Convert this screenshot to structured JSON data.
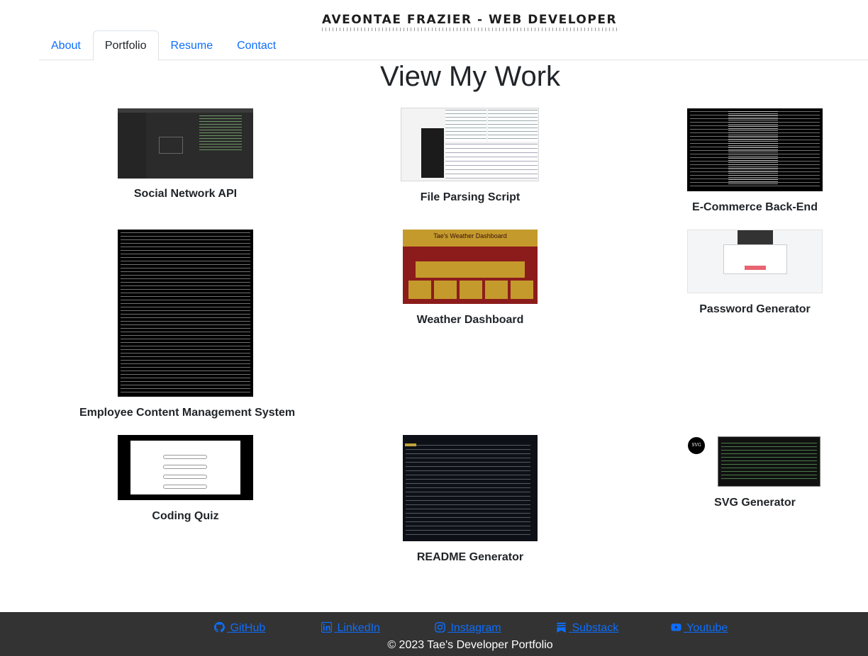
{
  "header": {
    "title": "AVEONTAE FRAZIER - WEB DEVELOPER"
  },
  "nav": {
    "tabs": [
      {
        "label": "About",
        "active": false
      },
      {
        "label": "Portfolio",
        "active": true
      },
      {
        "label": "Resume",
        "active": false
      },
      {
        "label": "Contact",
        "active": false
      }
    ]
  },
  "main": {
    "heading": "View My Work",
    "projects": [
      {
        "title": "Social Network API"
      },
      {
        "title": "File Parsing Script"
      },
      {
        "title": "E-Commerce Back-End"
      },
      {
        "title": "Employee Content Management System"
      },
      {
        "title": "Weather Dashboard",
        "thumb_text": "Tae's Weather Dashboard"
      },
      {
        "title": "Password Generator"
      },
      {
        "title": "Coding Quiz"
      },
      {
        "title": "README Generator"
      },
      {
        "title": "SVG Generator",
        "thumb_text": "SVG"
      }
    ]
  },
  "footer": {
    "links": [
      {
        "label": " GitHub",
        "icon": "github-icon"
      },
      {
        "label": " LinkedIn",
        "icon": "linkedin-icon"
      },
      {
        "label": " Instagram",
        "icon": "instagram-icon"
      },
      {
        "label": " Substack",
        "icon": "substack-icon"
      },
      {
        "label": " Youtube",
        "icon": "youtube-icon"
      }
    ],
    "copyright": "© 2023 Tae's Developer Portfolio"
  },
  "colors": {
    "link": "#0d6efd",
    "footer_bg": "#333333",
    "weather_red": "#8c1c1c",
    "weather_gold": "#c49a2c"
  }
}
